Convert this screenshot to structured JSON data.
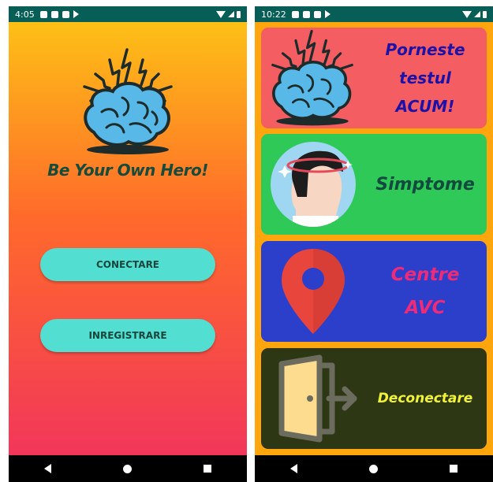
{
  "left_screen": {
    "status_time": "4:05",
    "status_icons": [
      "media-icon",
      "mail-icon",
      "sd-card-icon",
      "play-store-icon"
    ],
    "app_title": "Be Your Own Hero!",
    "login_button": "CONECTARE",
    "register_button": "INREGISTRARE",
    "colors": {
      "gradient_top": "#fdc016",
      "gradient_mid": "#ff6a2b",
      "gradient_bottom": "#f2365a",
      "button": "#52dfd2",
      "title": "#164a3a"
    }
  },
  "right_screen": {
    "status_time": "10:22",
    "status_icons": [
      "media-icon",
      "mail-icon",
      "sd-card-icon",
      "play-store-icon"
    ],
    "cards": [
      {
        "icon": "brain-icon",
        "label_lines": [
          "Porneste",
          "testul",
          "ACUM!"
        ],
        "bg": "#f45d61"
      },
      {
        "icon": "dizzy-head-icon",
        "label": "Simptome",
        "bg": "#2ec957"
      },
      {
        "icon": "map-pin-icon",
        "label_lines": [
          "Centre",
          "AVC"
        ],
        "bg": "#2b3fcb"
      },
      {
        "icon": "logout-door-icon",
        "label": "Deconectare",
        "bg": "#2e3714"
      }
    ]
  }
}
